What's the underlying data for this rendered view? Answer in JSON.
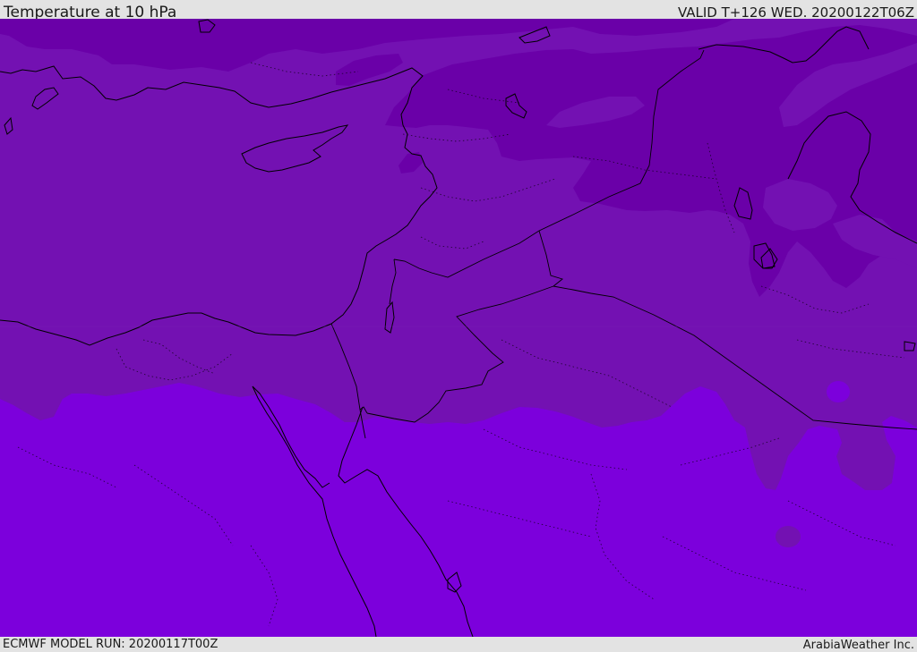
{
  "header": {
    "title": "Temperature at 10 hPa",
    "valid": "VALID T+126 WED. 20200122T06Z"
  },
  "footer": {
    "model_run": "ECMWF MODEL RUN: 20200117T00Z",
    "credit": "ArabiaWeather Inc."
  },
  "map": {
    "colors": {
      "warmest_band": "#7c00dc",
      "middle_band": "#7311b2",
      "cool_band": "#6a00a8",
      "coastline": "#000000"
    }
  }
}
